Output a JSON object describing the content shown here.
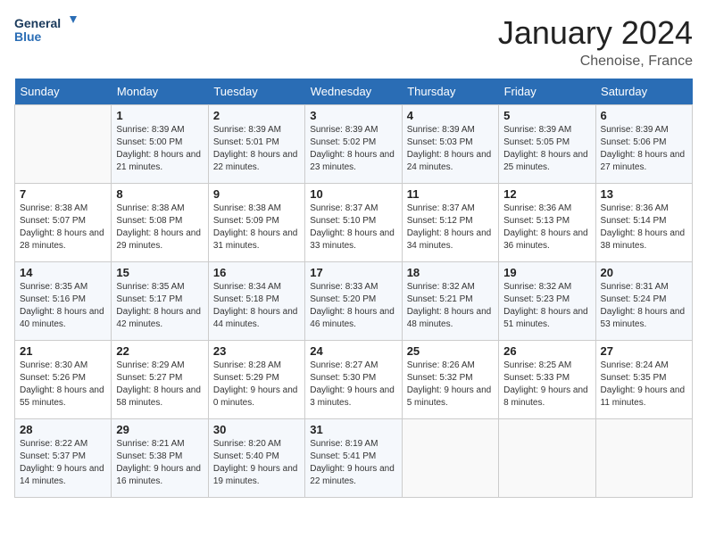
{
  "header": {
    "logo_line1": "General",
    "logo_line2": "Blue",
    "month": "January 2024",
    "location": "Chenoise, France"
  },
  "weekdays": [
    "Sunday",
    "Monday",
    "Tuesday",
    "Wednesday",
    "Thursday",
    "Friday",
    "Saturday"
  ],
  "weeks": [
    [
      {
        "day": "",
        "sunrise": "",
        "sunset": "",
        "daylight": ""
      },
      {
        "day": "1",
        "sunrise": "Sunrise: 8:39 AM",
        "sunset": "Sunset: 5:00 PM",
        "daylight": "Daylight: 8 hours and 21 minutes."
      },
      {
        "day": "2",
        "sunrise": "Sunrise: 8:39 AM",
        "sunset": "Sunset: 5:01 PM",
        "daylight": "Daylight: 8 hours and 22 minutes."
      },
      {
        "day": "3",
        "sunrise": "Sunrise: 8:39 AM",
        "sunset": "Sunset: 5:02 PM",
        "daylight": "Daylight: 8 hours and 23 minutes."
      },
      {
        "day": "4",
        "sunrise": "Sunrise: 8:39 AM",
        "sunset": "Sunset: 5:03 PM",
        "daylight": "Daylight: 8 hours and 24 minutes."
      },
      {
        "day": "5",
        "sunrise": "Sunrise: 8:39 AM",
        "sunset": "Sunset: 5:05 PM",
        "daylight": "Daylight: 8 hours and 25 minutes."
      },
      {
        "day": "6",
        "sunrise": "Sunrise: 8:39 AM",
        "sunset": "Sunset: 5:06 PM",
        "daylight": "Daylight: 8 hours and 27 minutes."
      }
    ],
    [
      {
        "day": "7",
        "sunrise": "Sunrise: 8:38 AM",
        "sunset": "Sunset: 5:07 PM",
        "daylight": "Daylight: 8 hours and 28 minutes."
      },
      {
        "day": "8",
        "sunrise": "Sunrise: 8:38 AM",
        "sunset": "Sunset: 5:08 PM",
        "daylight": "Daylight: 8 hours and 29 minutes."
      },
      {
        "day": "9",
        "sunrise": "Sunrise: 8:38 AM",
        "sunset": "Sunset: 5:09 PM",
        "daylight": "Daylight: 8 hours and 31 minutes."
      },
      {
        "day": "10",
        "sunrise": "Sunrise: 8:37 AM",
        "sunset": "Sunset: 5:10 PM",
        "daylight": "Daylight: 8 hours and 33 minutes."
      },
      {
        "day": "11",
        "sunrise": "Sunrise: 8:37 AM",
        "sunset": "Sunset: 5:12 PM",
        "daylight": "Daylight: 8 hours and 34 minutes."
      },
      {
        "day": "12",
        "sunrise": "Sunrise: 8:36 AM",
        "sunset": "Sunset: 5:13 PM",
        "daylight": "Daylight: 8 hours and 36 minutes."
      },
      {
        "day": "13",
        "sunrise": "Sunrise: 8:36 AM",
        "sunset": "Sunset: 5:14 PM",
        "daylight": "Daylight: 8 hours and 38 minutes."
      }
    ],
    [
      {
        "day": "14",
        "sunrise": "Sunrise: 8:35 AM",
        "sunset": "Sunset: 5:16 PM",
        "daylight": "Daylight: 8 hours and 40 minutes."
      },
      {
        "day": "15",
        "sunrise": "Sunrise: 8:35 AM",
        "sunset": "Sunset: 5:17 PM",
        "daylight": "Daylight: 8 hours and 42 minutes."
      },
      {
        "day": "16",
        "sunrise": "Sunrise: 8:34 AM",
        "sunset": "Sunset: 5:18 PM",
        "daylight": "Daylight: 8 hours and 44 minutes."
      },
      {
        "day": "17",
        "sunrise": "Sunrise: 8:33 AM",
        "sunset": "Sunset: 5:20 PM",
        "daylight": "Daylight: 8 hours and 46 minutes."
      },
      {
        "day": "18",
        "sunrise": "Sunrise: 8:32 AM",
        "sunset": "Sunset: 5:21 PM",
        "daylight": "Daylight: 8 hours and 48 minutes."
      },
      {
        "day": "19",
        "sunrise": "Sunrise: 8:32 AM",
        "sunset": "Sunset: 5:23 PM",
        "daylight": "Daylight: 8 hours and 51 minutes."
      },
      {
        "day": "20",
        "sunrise": "Sunrise: 8:31 AM",
        "sunset": "Sunset: 5:24 PM",
        "daylight": "Daylight: 8 hours and 53 minutes."
      }
    ],
    [
      {
        "day": "21",
        "sunrise": "Sunrise: 8:30 AM",
        "sunset": "Sunset: 5:26 PM",
        "daylight": "Daylight: 8 hours and 55 minutes."
      },
      {
        "day": "22",
        "sunrise": "Sunrise: 8:29 AM",
        "sunset": "Sunset: 5:27 PM",
        "daylight": "Daylight: 8 hours and 58 minutes."
      },
      {
        "day": "23",
        "sunrise": "Sunrise: 8:28 AM",
        "sunset": "Sunset: 5:29 PM",
        "daylight": "Daylight: 9 hours and 0 minutes."
      },
      {
        "day": "24",
        "sunrise": "Sunrise: 8:27 AM",
        "sunset": "Sunset: 5:30 PM",
        "daylight": "Daylight: 9 hours and 3 minutes."
      },
      {
        "day": "25",
        "sunrise": "Sunrise: 8:26 AM",
        "sunset": "Sunset: 5:32 PM",
        "daylight": "Daylight: 9 hours and 5 minutes."
      },
      {
        "day": "26",
        "sunrise": "Sunrise: 8:25 AM",
        "sunset": "Sunset: 5:33 PM",
        "daylight": "Daylight: 9 hours and 8 minutes."
      },
      {
        "day": "27",
        "sunrise": "Sunrise: 8:24 AM",
        "sunset": "Sunset: 5:35 PM",
        "daylight": "Daylight: 9 hours and 11 minutes."
      }
    ],
    [
      {
        "day": "28",
        "sunrise": "Sunrise: 8:22 AM",
        "sunset": "Sunset: 5:37 PM",
        "daylight": "Daylight: 9 hours and 14 minutes."
      },
      {
        "day": "29",
        "sunrise": "Sunrise: 8:21 AM",
        "sunset": "Sunset: 5:38 PM",
        "daylight": "Daylight: 9 hours and 16 minutes."
      },
      {
        "day": "30",
        "sunrise": "Sunrise: 8:20 AM",
        "sunset": "Sunset: 5:40 PM",
        "daylight": "Daylight: 9 hours and 19 minutes."
      },
      {
        "day": "31",
        "sunrise": "Sunrise: 8:19 AM",
        "sunset": "Sunset: 5:41 PM",
        "daylight": "Daylight: 9 hours and 22 minutes."
      },
      {
        "day": "",
        "sunrise": "",
        "sunset": "",
        "daylight": ""
      },
      {
        "day": "",
        "sunrise": "",
        "sunset": "",
        "daylight": ""
      },
      {
        "day": "",
        "sunrise": "",
        "sunset": "",
        "daylight": ""
      }
    ]
  ]
}
